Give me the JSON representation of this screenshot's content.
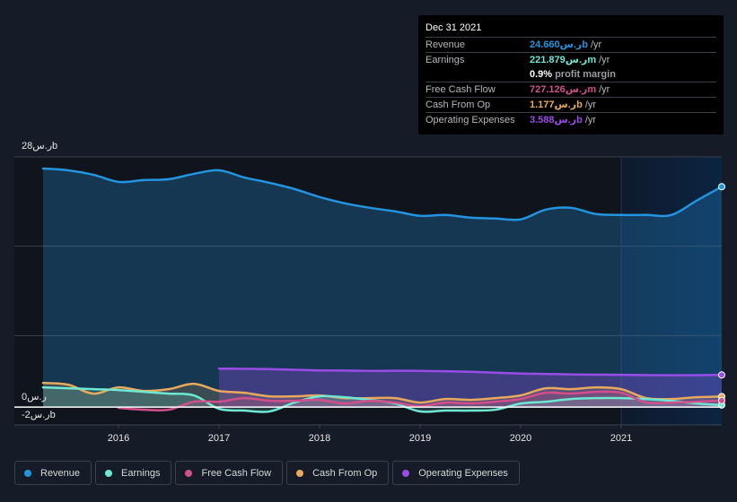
{
  "tooltip": {
    "date": "Dec 31 2021",
    "rows": [
      {
        "label": "Revenue",
        "value": "24.660ر.سb",
        "unit": "/yr",
        "color": "#2394df"
      },
      {
        "label": "Earnings",
        "value": "221.879ر.سm",
        "unit": "/yr",
        "color": "#6ee7d3"
      },
      {
        "label": "",
        "value": "0.9%",
        "unit": "profit margin",
        "color": "#ffffff"
      },
      {
        "label": "Free Cash Flow",
        "value": "727.126ر.سm",
        "unit": "/yr",
        "color": "#d14f8b"
      },
      {
        "label": "Cash From Op",
        "value": "1.177ر.سb",
        "unit": "/yr",
        "color": "#e8a95c"
      },
      {
        "label": "Operating Expenses",
        "value": "3.588ر.سb",
        "unit": "/yr",
        "color": "#9a4ce8"
      }
    ]
  },
  "legend": [
    {
      "label": "Revenue",
      "color": "#2394df"
    },
    {
      "label": "Earnings",
      "color": "#6ee7d3"
    },
    {
      "label": "Free Cash Flow",
      "color": "#d14f8b"
    },
    {
      "label": "Cash From Op",
      "color": "#e8a95c"
    },
    {
      "label": "Operating Expenses",
      "color": "#9a4ce8"
    }
  ],
  "chart_data": {
    "type": "area",
    "title": "",
    "xlabel": "",
    "ylabel": "",
    "y_unit": "ر.س billions",
    "ylim": [
      -2,
      28
    ],
    "xlim": [
      2015.25,
      2022.0
    ],
    "x_ticks": [
      "2016",
      "2017",
      "2018",
      "2019",
      "2020",
      "2021"
    ],
    "y_tick_labels": {
      "top": "28ر.سb",
      "zero": "0ر.س",
      "bottom": "-2ر.سb"
    },
    "highlight_start": 2021.0,
    "grid": true,
    "legend_position": "bottom",
    "series": [
      {
        "name": "Revenue",
        "color": "#2394df",
        "x": [
          2015.25,
          2015.5,
          2015.75,
          2016.0,
          2016.25,
          2016.5,
          2016.75,
          2017.0,
          2017.25,
          2017.5,
          2017.75,
          2018.0,
          2018.25,
          2018.5,
          2018.75,
          2019.0,
          2019.25,
          2019.5,
          2019.75,
          2020.0,
          2020.25,
          2020.5,
          2020.75,
          2021.0,
          2021.25,
          2021.5,
          2021.75,
          2022.0
        ],
        "values": [
          26.7,
          26.5,
          26.0,
          25.2,
          25.4,
          25.5,
          26.1,
          26.5,
          25.7,
          25.1,
          24.4,
          23.5,
          22.8,
          22.3,
          21.9,
          21.4,
          21.5,
          21.2,
          21.1,
          21.0,
          22.1,
          22.3,
          21.6,
          21.5,
          21.5,
          21.5,
          23.1,
          24.66
        ]
      },
      {
        "name": "Operating Expenses",
        "color": "#9a4ce8",
        "x": [
          2017.0,
          2017.5,
          2018.0,
          2018.5,
          2019.0,
          2019.5,
          2020.0,
          2020.5,
          2021.0,
          2021.5,
          2022.0
        ],
        "values": [
          4.3,
          4.25,
          4.1,
          4.05,
          4.05,
          3.95,
          3.75,
          3.65,
          3.6,
          3.55,
          3.588
        ]
      },
      {
        "name": "Cash From Op",
        "color": "#e8a95c",
        "x": [
          2015.25,
          2015.5,
          2015.75,
          2016.0,
          2016.25,
          2016.5,
          2016.75,
          2017.0,
          2017.25,
          2017.5,
          2017.75,
          2018.0,
          2018.25,
          2018.5,
          2018.75,
          2019.0,
          2019.25,
          2019.5,
          2019.75,
          2020.0,
          2020.25,
          2020.5,
          2020.75,
          2021.0,
          2021.25,
          2021.5,
          2021.75,
          2022.0
        ],
        "values": [
          2.7,
          2.5,
          1.5,
          2.2,
          1.8,
          2.0,
          2.6,
          1.8,
          1.6,
          1.2,
          1.2,
          1.3,
          1.0,
          1.0,
          1.0,
          0.5,
          0.9,
          0.8,
          1.0,
          1.3,
          2.1,
          2.0,
          2.2,
          2.0,
          1.0,
          0.9,
          1.1,
          1.177
        ]
      },
      {
        "name": "Earnings",
        "color": "#6ee7d3",
        "x": [
          2015.25,
          2015.5,
          2015.75,
          2016.0,
          2016.25,
          2016.5,
          2016.75,
          2017.0,
          2017.25,
          2017.5,
          2017.75,
          2018.0,
          2018.25,
          2018.5,
          2018.75,
          2019.0,
          2019.25,
          2019.5,
          2019.75,
          2020.0,
          2020.25,
          2020.5,
          2020.75,
          2021.0,
          2021.25,
          2021.5,
          2021.75,
          2022.0
        ],
        "values": [
          2.2,
          2.1,
          2.0,
          1.9,
          1.7,
          1.5,
          1.3,
          -0.2,
          -0.4,
          -0.5,
          0.5,
          1.2,
          1.1,
          0.8,
          0.4,
          -0.5,
          -0.4,
          -0.4,
          -0.3,
          0.4,
          0.6,
          0.9,
          1.0,
          1.0,
          0.9,
          0.7,
          0.4,
          0.222
        ]
      },
      {
        "name": "Free Cash Flow",
        "color": "#d14f8b",
        "x": [
          2016.0,
          2016.25,
          2016.5,
          2016.75,
          2017.0,
          2017.25,
          2017.5,
          2017.75,
          2018.0,
          2018.25,
          2018.5,
          2018.75,
          2019.0,
          2019.25,
          2019.5,
          2019.75,
          2020.0,
          2020.25,
          2020.5,
          2020.75,
          2021.0,
          2021.25,
          2021.5,
          2021.75,
          2022.0
        ],
        "values": [
          -0.1,
          -0.3,
          -0.3,
          0.6,
          0.6,
          1.0,
          0.7,
          0.7,
          0.8,
          0.4,
          0.7,
          0.5,
          0.1,
          0.5,
          0.4,
          0.6,
          0.9,
          1.6,
          1.5,
          1.7,
          1.6,
          0.5,
          0.5,
          0.6,
          0.727
        ]
      }
    ]
  }
}
